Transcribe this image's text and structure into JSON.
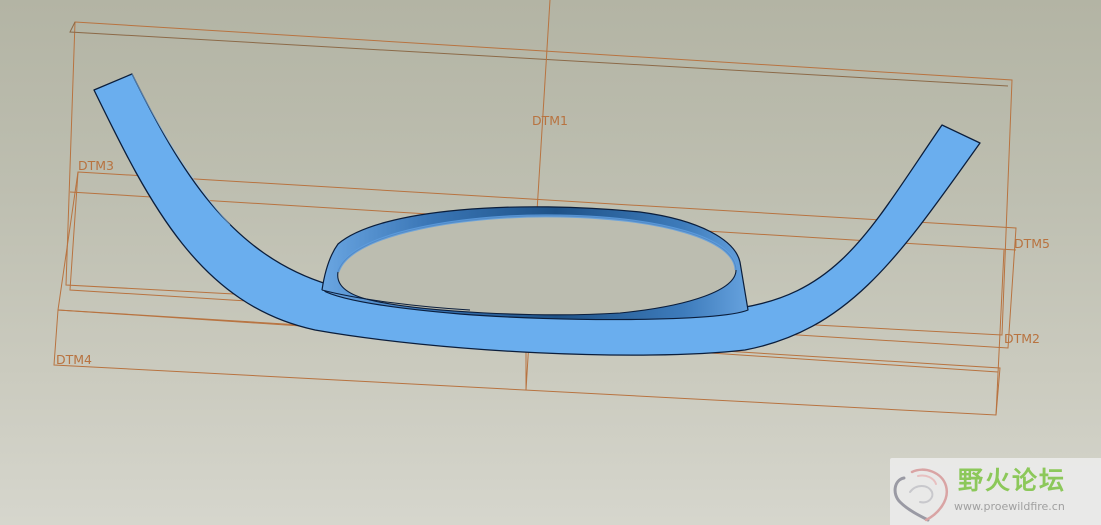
{
  "viewport": {
    "background_top": "#b3b4a4",
    "background_bottom": "#d6d6cd",
    "datum_color": "#b87340",
    "surface_color": "#6aaeee",
    "ring_color": "#3f7dbf"
  },
  "datums": {
    "dtm1": "DTM1",
    "dtm2": "DTM2",
    "dtm3": "DTM3",
    "dtm4": "DTM4",
    "dtm5": "DTM5"
  },
  "watermark": {
    "title": "野火论坛",
    "url": "www.proewildfire.cn",
    "title_color": "#8cc85a",
    "logo_icon": "heart-swirl-logo-icon"
  }
}
